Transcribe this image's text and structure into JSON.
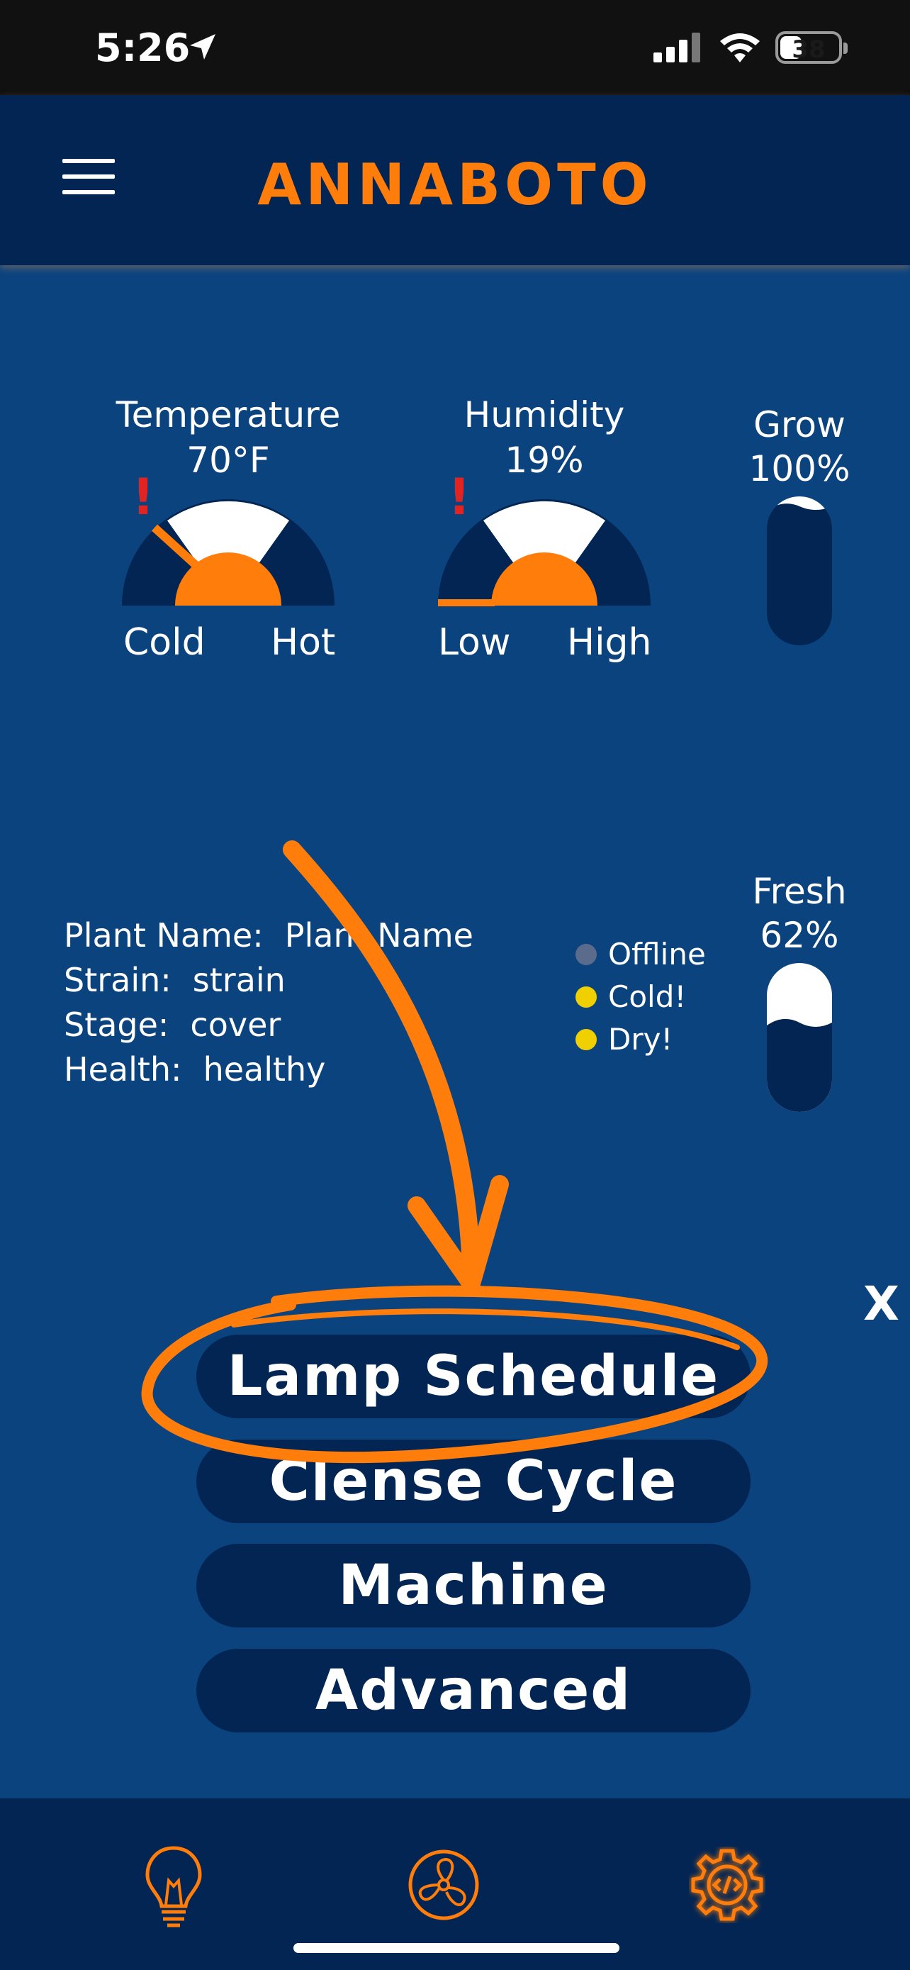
{
  "status_bar": {
    "time": "5:26",
    "battery": "38"
  },
  "header": {
    "title": "ANNABOTO"
  },
  "gauges": {
    "temperature": {
      "title": "Temperature",
      "value": "70°F",
      "low_label": "Cold",
      "high_label": "Hot",
      "warning": "!"
    },
    "humidity": {
      "title": "Humidity",
      "value": "19%",
      "low_label": "Low",
      "high_label": "High",
      "warning": "!"
    }
  },
  "meters": {
    "grow": {
      "title": "Grow",
      "value": "100%",
      "level": 1.0
    },
    "fresh": {
      "title": "Fresh",
      "value": "62%",
      "level": 0.62
    }
  },
  "plant": {
    "name_key": "Plant Name:",
    "name_val": "Plant Name",
    "strain_key": "Strain:",
    "strain_val": "strain",
    "stage_key": "Stage:",
    "stage_val": "cover",
    "health_key": "Health:",
    "health_val": "healthy"
  },
  "legend": [
    {
      "label": "Offline",
      "color": "#5a6b8c"
    },
    {
      "label": "Cold!",
      "color": "#f0d000"
    },
    {
      "label": "Dry!",
      "color": "#f0d000"
    }
  ],
  "close_label": "X",
  "menu": {
    "lamp_schedule": "Lamp Schedule",
    "clense_cycle": "Clense Cycle",
    "machine": "Machine",
    "advanced": "Advanced"
  },
  "bottom_nav": {
    "icons": [
      "lightbulb-icon",
      "fan-icon",
      "gear-code-icon"
    ]
  },
  "colors": {
    "accent": "#ff7d0a",
    "background": "#0b437f",
    "panel": "#032553",
    "warning": "#e02424"
  }
}
